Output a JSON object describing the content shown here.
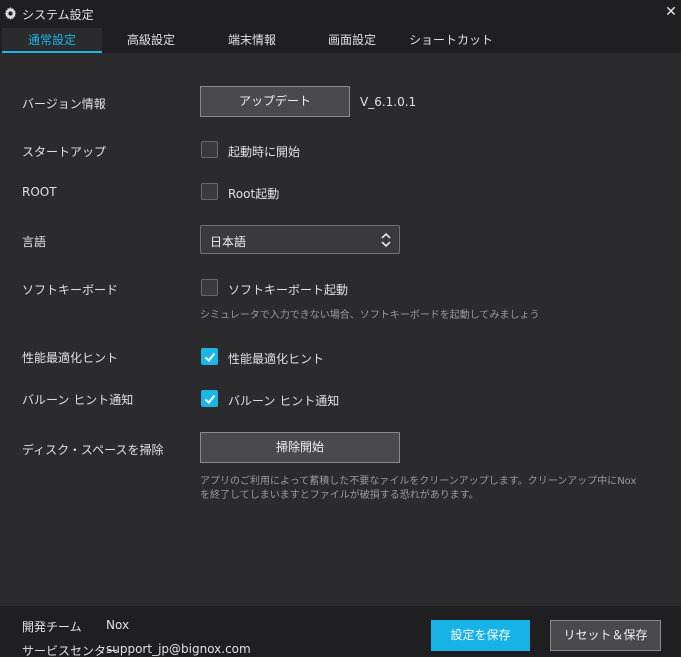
{
  "window": {
    "title": "システム設定",
    "close_icon": "close-icon"
  },
  "tabs": [
    {
      "label": "通常設定",
      "active": true
    },
    {
      "label": "高級設定",
      "active": false
    },
    {
      "label": "端末情報",
      "active": false
    },
    {
      "label": "画面設定",
      "active": false
    },
    {
      "label": "ショートカット",
      "active": false
    }
  ],
  "settings": {
    "version": {
      "label": "バージョン情報",
      "button": "アップデート",
      "value": "V_6.1.0.1"
    },
    "startup": {
      "label": "スタートアップ",
      "checkbox_label": "起動時に開始",
      "checked": false
    },
    "root": {
      "label": "ROOT",
      "checkbox_label": "Root起動",
      "checked": false
    },
    "language": {
      "label": "言語",
      "selected": "日本語"
    },
    "soft_keyboard": {
      "label": "ソフトキーボード",
      "checkbox_label": "ソフトキーボート起動",
      "checked": false,
      "hint": "シミュレータで入力できない場合、ソフトキーボードを起動してみましょう"
    },
    "performance": {
      "label": "性能最適化ヒント",
      "checkbox_label": "性能最適化ヒント",
      "checked": true
    },
    "balloon": {
      "label": "バルーン ヒント通知",
      "checkbox_label": "バルーン ヒント通知",
      "checked": true
    },
    "disk_cleanup": {
      "label": "ディスク・スペースを掃除",
      "button": "掃除開始",
      "hint": "アプリのご利用によって蓄積した不要なァイルをクリーンアップします。クリーンアップ中にNoxを終了してしまいますとファイルが破損する恐れがあります。"
    }
  },
  "footer": {
    "dev_team_label": "開発チーム",
    "dev_team_value": "Nox",
    "service_label": "サービスセンター",
    "service_value": "support_jp@bignox.com",
    "save_button": "設定を保存",
    "reset_button": "リセット＆保存"
  },
  "colors": {
    "accent": "#1bb6e6",
    "background": "#2b2b2e",
    "bar": "#1f1f21"
  }
}
